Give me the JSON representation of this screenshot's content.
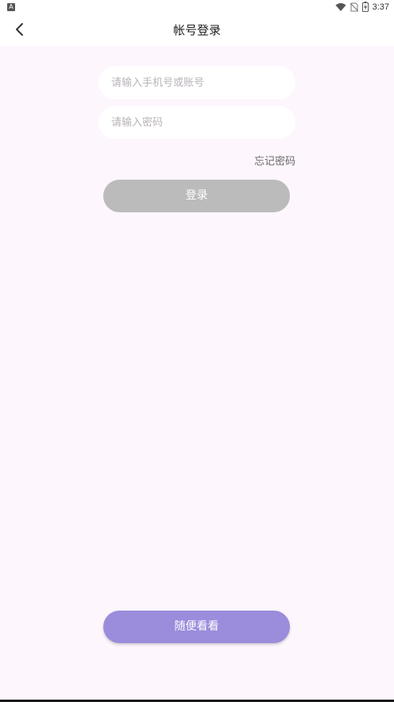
{
  "status_bar": {
    "notification_icon": "A",
    "time": "3:37",
    "icons": [
      "wifi-icon",
      "no-sim-icon",
      "battery-charging-icon"
    ]
  },
  "header": {
    "title": "帐号登录",
    "back_icon": "chevron-left-icon"
  },
  "form": {
    "account_placeholder": "请输入手机号或账号",
    "password_placeholder": "请输入密码",
    "forgot_label": "忘记密码",
    "login_label": "登录"
  },
  "footer": {
    "browse_label": "随便看看"
  },
  "colors": {
    "background": "#fdf6fd",
    "login_disabled": "#bbbbbb",
    "accent": "#9b8cdc"
  }
}
